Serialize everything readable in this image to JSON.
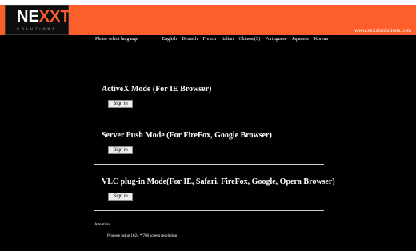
{
  "header": {
    "logo": {
      "part1": "NE",
      "part2": "XXT",
      "subtext": "SOLUTIONS"
    },
    "site_url": "www.nexxtsolutions.com"
  },
  "language_bar": {
    "label": "Please select language",
    "languages": [
      "English",
      "Deutsch",
      "French",
      "Italian",
      "Chinese(S)",
      "Portuguese",
      "Japanese",
      "Korean"
    ]
  },
  "modes": [
    {
      "title": "ActiveX Mode (For IE Browser)",
      "button": "Sign in"
    },
    {
      "title": "Server Push Mode (For FireFox, Google Browser)",
      "button": "Sign in"
    },
    {
      "title": "VLC plug-in Mode(For IE, Safari, FireFox, Google, Opera Browser)",
      "button": "Sign in"
    }
  ],
  "attention": {
    "title": "Attention:",
    "text": "Propose using 1024 * 768 screen resolution"
  },
  "colors": {
    "header_bg": "#fd5f2b",
    "page_bg": "#000000"
  }
}
